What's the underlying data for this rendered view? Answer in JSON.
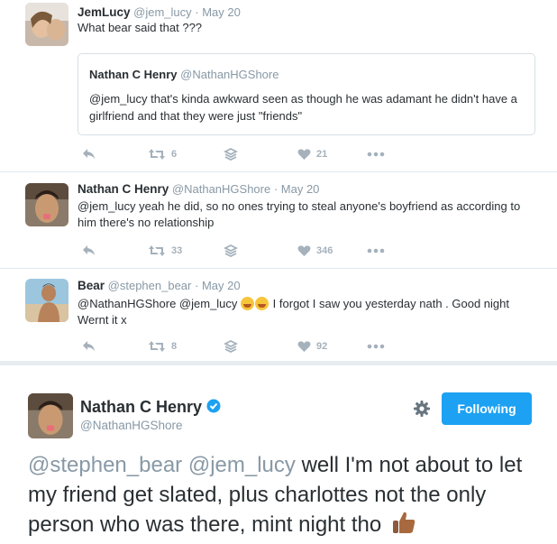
{
  "tweets": [
    {
      "name": "JemLucy",
      "handle": "@jem_lucy",
      "date": "· May 20",
      "text": "What bear said that ???",
      "quote": {
        "name": "Nathan C Henry",
        "handle": "@NathanHGShore",
        "text": "@jem_lucy that's kinda awkward seen as though he was adamant he didn't have a girlfriend and that they were just \"friends\""
      },
      "retweets": "6",
      "likes": "21"
    },
    {
      "name": "Nathan C Henry",
      "handle": "@NathanHGShore",
      "date": "· May 20",
      "mention": "@jem_lucy",
      "text": "yeah he did, so no ones trying to steal anyone's boyfriend as according to him there's no relationship",
      "retweets": "33",
      "likes": "346"
    },
    {
      "name": "Bear",
      "handle": "@stephen_bear",
      "date": "· May 20",
      "mentions": "@NathanHGShore @jem_lucy",
      "text_after_emoji": "I forgot I saw you yesterday nath . Good night Wernt it x",
      "retweets": "8",
      "likes": "92"
    }
  ],
  "main_tweet": {
    "name": "Nathan C Henry",
    "handle": "@NathanHGShore",
    "follow_label": "Following",
    "mention1": "@stephen_bear",
    "mention2": "@jem_lucy",
    "text": "well I'm not about to let my friend get slated, plus charlottes not the only person who was there, mint night tho"
  },
  "colors": {
    "accent": "#1da1f2",
    "muted": "#8899a6",
    "text": "#292f33",
    "background": "#e6ecf0"
  },
  "icons": [
    "reply-icon",
    "retweet-icon",
    "stack-icon",
    "heart-icon",
    "more-icon",
    "gear-icon",
    "verified-icon",
    "thumbs-up-emoji"
  ]
}
